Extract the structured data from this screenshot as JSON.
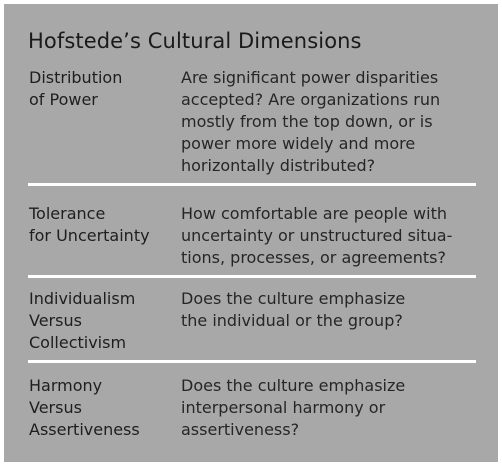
{
  "title": "Hofstede’s Cultural Dimensions",
  "rows": [
    {
      "term": "Distribution\nof Power",
      "description": "Are significant power disparities\naccepted? Are organizations run\nmostly from the top down, or is\npower more widely and more\nhorizontally distributed?"
    },
    {
      "term": "Tolerance\nfor Uncertainty",
      "description": "How comfortable are people with\nuncertainty or unstructured situa-\ntions, processes, or agreements?"
    },
    {
      "term": "Individualism\nVersus\nCollectivism",
      "description": "Does the culture emphasize\nthe individual or the group?"
    },
    {
      "term": "Harmony\nVersus\nAssertiveness",
      "description": "Does the culture emphasize\ninterpersonal harmony or\nassertiveness?"
    }
  ]
}
